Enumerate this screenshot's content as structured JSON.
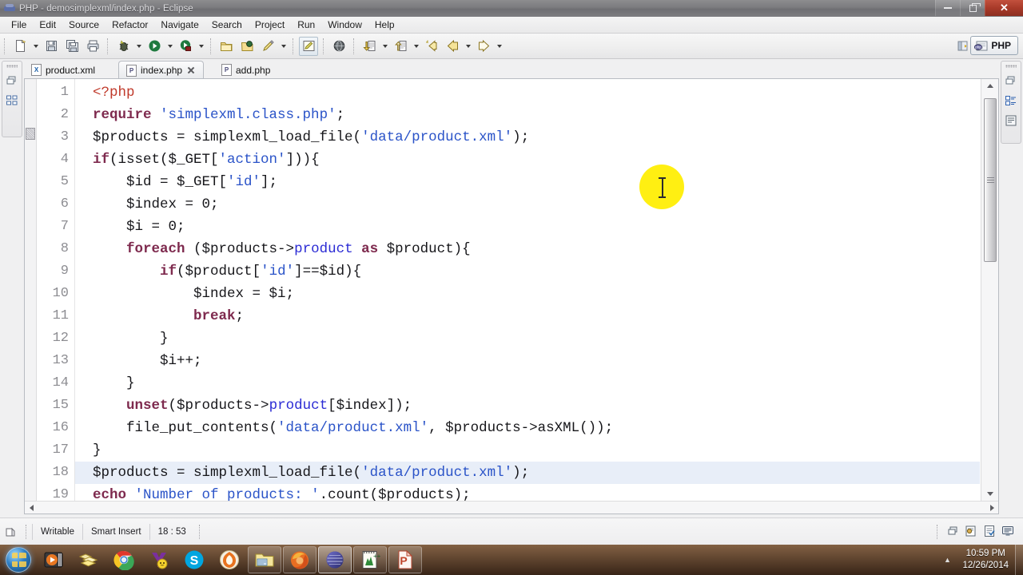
{
  "window": {
    "title": "PHP - demosimplexml/index.php - Eclipse",
    "app_icon": "eclipse-icon",
    "controls": [
      {
        "name": "minimize-button",
        "glyph": "minimize-icon"
      },
      {
        "name": "restore-button",
        "glyph": "restore-icon"
      },
      {
        "name": "close-button",
        "glyph": "close-icon",
        "label": "✕"
      }
    ]
  },
  "menubar": {
    "items": [
      {
        "label": "File"
      },
      {
        "label": "Edit"
      },
      {
        "label": "Source"
      },
      {
        "label": "Refactor"
      },
      {
        "label": "Navigate"
      },
      {
        "label": "Search"
      },
      {
        "label": "Project"
      },
      {
        "label": "Run"
      },
      {
        "label": "Window"
      },
      {
        "label": "Help"
      }
    ]
  },
  "toolbar": {
    "groups": [
      {
        "buttons": [
          {
            "name": "new-wizard-button",
            "icon": "new-file-icon",
            "dropdown": true
          },
          {
            "name": "save-button",
            "icon": "save-icon",
            "dropdown": false
          },
          {
            "name": "save-all-button",
            "icon": "save-all-icon",
            "dropdown": false
          },
          {
            "name": "print-button",
            "icon": "print-icon",
            "dropdown": false
          }
        ]
      },
      {
        "buttons": [
          {
            "name": "debug-button",
            "icon": "debug-bug-icon",
            "dropdown": true
          },
          {
            "name": "run-button",
            "icon": "run-play-icon",
            "dropdown": true
          },
          {
            "name": "profile-button",
            "icon": "profile-icon",
            "dropdown": true
          }
        ]
      },
      {
        "buttons": [
          {
            "name": "open-type-button",
            "icon": "open-folder-icon",
            "dropdown": false
          },
          {
            "name": "open-resource-button",
            "icon": "open-resource-icon",
            "dropdown": false
          },
          {
            "name": "quick-fix-button",
            "icon": "pencil-icon",
            "dropdown": true
          }
        ]
      },
      {
        "buttons": [
          {
            "name": "toggle-mark-occurrences-button",
            "icon": "highlight-editor-icon",
            "dropdown": false
          }
        ]
      },
      {
        "buttons": [
          {
            "name": "open-browser-button",
            "icon": "globe-icon",
            "dropdown": false
          }
        ]
      },
      {
        "buttons": [
          {
            "name": "next-annotation-button",
            "icon": "next-annotation-icon",
            "dropdown": true
          },
          {
            "name": "previous-annotation-button",
            "icon": "previous-annotation-icon",
            "dropdown": true
          },
          {
            "name": "last-edit-location-button",
            "icon": "last-edit-location-icon",
            "dropdown": false
          },
          {
            "name": "back-button",
            "icon": "back-arrow-icon",
            "dropdown": true
          },
          {
            "name": "forward-button",
            "icon": "forward-arrow-icon",
            "dropdown": true
          }
        ]
      }
    ],
    "perspective": {
      "open_label": "open-perspective-icon",
      "current": "PHP",
      "current_icon": "php-perspective-icon"
    }
  },
  "left_view_bar": {
    "icons": [
      "restore-view-icon",
      "php-explorer-icon"
    ]
  },
  "right_view_bar": {
    "icons": [
      "restore-view-icon",
      "outline-view-icon",
      "task-list-icon"
    ]
  },
  "editor": {
    "tabs": [
      {
        "label": "product.xml",
        "icon": "xml-file-icon",
        "icon_letter": "X",
        "active": false,
        "closable": false
      },
      {
        "label": "index.php",
        "icon": "php-file-icon",
        "icon_letter": "P",
        "active": true,
        "closable": true
      },
      {
        "label": "add.php",
        "icon": "php-file-icon",
        "icon_letter": "P",
        "active": false,
        "closable": false
      }
    ],
    "current_line": 18,
    "lines": [
      {
        "n": "1",
        "tokens": [
          {
            "t": "<?php",
            "c": "t"
          }
        ]
      },
      {
        "n": "2",
        "tokens": [
          {
            "t": "require",
            "c": "k"
          },
          {
            "t": " ",
            "c": "d"
          },
          {
            "t": "'simplexml.class.php'",
            "c": "s"
          },
          {
            "t": ";",
            "c": "d"
          }
        ]
      },
      {
        "n": "3",
        "tokens": [
          {
            "t": "$products = simplexml_load_file(",
            "c": "d"
          },
          {
            "t": "'data/product.xml'",
            "c": "s"
          },
          {
            "t": ");",
            "c": "d"
          }
        ]
      },
      {
        "n": "4",
        "tokens": [
          {
            "t": "if",
            "c": "k"
          },
          {
            "t": "(isset($_GET[",
            "c": "d"
          },
          {
            "t": "'action'",
            "c": "s"
          },
          {
            "t": "])){",
            "c": "d"
          }
        ]
      },
      {
        "n": "5",
        "tokens": [
          {
            "t": "    $id = $_GET[",
            "c": "d"
          },
          {
            "t": "'id'",
            "c": "s"
          },
          {
            "t": "];",
            "c": "d"
          }
        ]
      },
      {
        "n": "6",
        "tokens": [
          {
            "t": "    $index = 0;",
            "c": "d"
          }
        ]
      },
      {
        "n": "7",
        "tokens": [
          {
            "t": "    $i = 0;",
            "c": "d"
          }
        ]
      },
      {
        "n": "8",
        "tokens": [
          {
            "t": "    ",
            "c": "d"
          },
          {
            "t": "foreach",
            "c": "k"
          },
          {
            "t": " ($products->",
            "c": "d"
          },
          {
            "t": "product",
            "c": "p"
          },
          {
            "t": " ",
            "c": "d"
          },
          {
            "t": "as",
            "c": "k"
          },
          {
            "t": " $product){",
            "c": "d"
          }
        ]
      },
      {
        "n": "9",
        "tokens": [
          {
            "t": "        ",
            "c": "d"
          },
          {
            "t": "if",
            "c": "k"
          },
          {
            "t": "($product[",
            "c": "d"
          },
          {
            "t": "'id'",
            "c": "s"
          },
          {
            "t": "]==$id){",
            "c": "d"
          }
        ]
      },
      {
        "n": "10",
        "tokens": [
          {
            "t": "            $index = $i;",
            "c": "d"
          }
        ]
      },
      {
        "n": "11",
        "tokens": [
          {
            "t": "            ",
            "c": "d"
          },
          {
            "t": "break",
            "c": "k"
          },
          {
            "t": ";",
            "c": "d"
          }
        ]
      },
      {
        "n": "12",
        "tokens": [
          {
            "t": "        }",
            "c": "d"
          }
        ]
      },
      {
        "n": "13",
        "tokens": [
          {
            "t": "        $i++;",
            "c": "d"
          }
        ]
      },
      {
        "n": "14",
        "tokens": [
          {
            "t": "    }",
            "c": "d"
          }
        ]
      },
      {
        "n": "15",
        "tokens": [
          {
            "t": "    ",
            "c": "d"
          },
          {
            "t": "unset",
            "c": "k"
          },
          {
            "t": "($products->",
            "c": "d"
          },
          {
            "t": "product",
            "c": "p"
          },
          {
            "t": "[$index]);",
            "c": "d"
          }
        ]
      },
      {
        "n": "16",
        "tokens": [
          {
            "t": "    file_put_contents(",
            "c": "d"
          },
          {
            "t": "'data/product.xml'",
            "c": "s"
          },
          {
            "t": ", $products->asXML());",
            "c": "d"
          }
        ]
      },
      {
        "n": "17",
        "tokens": [
          {
            "t": "}",
            "c": "d"
          }
        ]
      },
      {
        "n": "18",
        "tokens": [
          {
            "t": "$products = simplexml_load_file(",
            "c": "d"
          },
          {
            "t": "'data/product.xml'",
            "c": "s"
          },
          {
            "t": ");",
            "c": "d"
          }
        ]
      },
      {
        "n": "19",
        "tokens": [
          {
            "t": "echo",
            "c": "k"
          },
          {
            "t": " ",
            "c": "d"
          },
          {
            "t": "'Number of products: '",
            "c": "s"
          },
          {
            "t": ".count($products);",
            "c": "d"
          }
        ]
      }
    ]
  },
  "statusbar": {
    "left_icon": "writable-indicator-icon",
    "fields": [
      {
        "name": "writable-status",
        "value": "Writable"
      },
      {
        "name": "insert-mode-status",
        "value": "Smart Insert"
      },
      {
        "name": "cursor-position-status",
        "value": "18 : 53"
      }
    ],
    "right_icons": [
      "restore-trim-icon",
      "build-status-icon",
      "tasks-icon",
      "console-icon"
    ]
  },
  "taskbar": {
    "start": {
      "name": "start-button",
      "icon": "windows-start-orb-icon"
    },
    "quick_launch": [
      {
        "name": "media-player-task",
        "icon": "media-player-icon",
        "state": "pinned"
      },
      {
        "name": "explorer-task",
        "icon": "file-explorer-icon",
        "state": "pinned"
      },
      {
        "name": "chrome-task",
        "icon": "chrome-icon",
        "state": "pinned"
      },
      {
        "name": "yahoo-messenger-task",
        "icon": "yahoo-messenger-icon",
        "state": "pinned"
      },
      {
        "name": "skype-task",
        "icon": "skype-icon",
        "state": "pinned"
      },
      {
        "name": "avast-task",
        "icon": "avast-icon",
        "state": "pinned"
      },
      {
        "name": "explorer-window-task",
        "icon": "folder-window-icon",
        "state": "running"
      },
      {
        "name": "firefox-window-task",
        "icon": "firefox-icon",
        "state": "running"
      },
      {
        "name": "eclipse-window-task",
        "icon": "eclipse-icon",
        "state": "active"
      },
      {
        "name": "notepadpp-window-task",
        "icon": "notepad-plus-plus-icon",
        "state": "running"
      },
      {
        "name": "powerpoint-window-task",
        "icon": "powerpoint-icon",
        "state": "running"
      }
    ],
    "tray": {
      "arrow_icon": "show-hidden-icons-icon",
      "time": "10:59 PM",
      "date": "12/26/2014"
    }
  },
  "cursor": {
    "type": "text-ibeam-cursor",
    "highlight_color": "#ffee00"
  },
  "colors": {
    "keyword": "#7e2a4e",
    "string": "#2a53c8",
    "tag": "#2b2bd4",
    "php_open": "#c03a2b",
    "current_line": "#e8eef8",
    "accent": "#ffee00"
  }
}
